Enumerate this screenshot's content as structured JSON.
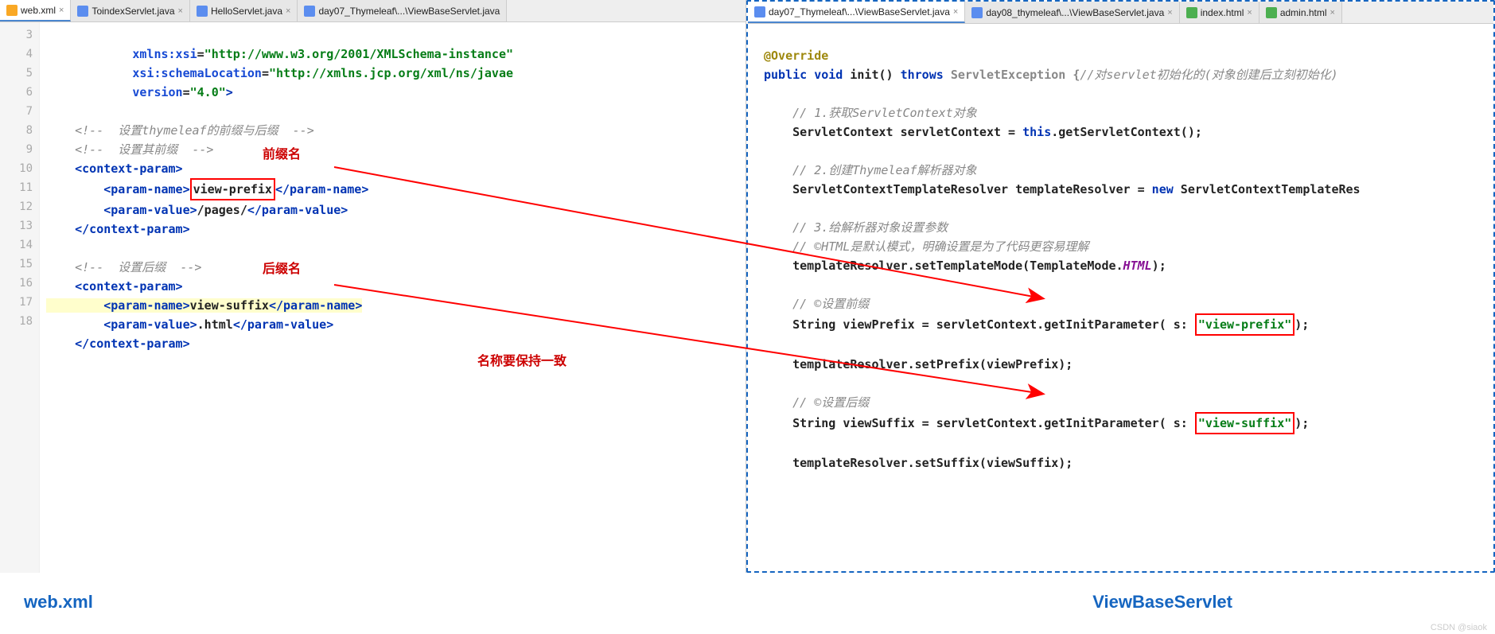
{
  "leftPane": {
    "tabs": [
      {
        "label": "web.xml",
        "icon": "xml-icon",
        "active": true
      },
      {
        "label": "ToindexServlet.java",
        "icon": "java-icon",
        "active": false
      },
      {
        "label": "HelloServlet.java",
        "icon": "java-icon",
        "active": false
      },
      {
        "label": "day07_Thymeleaf\\...\\ViewBaseServlet.java",
        "icon": "java-icon",
        "active": false
      }
    ],
    "lineStart": 3,
    "lineCount": 16,
    "code": {
      "l3": "            xmlns:xsi=\"http://www.w3.org/2001/XMLSchema-instance\"",
      "l4": "            xsi:schemaLocation=\"http://xmlns.jcp.org/xml/ns/javae",
      "l5": "            version=\"4.0\">",
      "l6": "",
      "l7": "    <!--  设置thymeleaf的前缀与后缀  -->",
      "l8": "    <!--  设置其前缀  -->",
      "l9a": "<",
      "l9b": "context-param",
      "l9c": ">",
      "l10a": "<",
      "l10b": "param-name",
      "l10c": ">",
      "l10d": "view-prefix",
      "l10e": "</",
      "l10f": "param-name",
      "l10g": ">",
      "l11a": "<",
      "l11b": "param-value",
      "l11c": ">",
      "l11d": "/pages/",
      "l11e": "</",
      "l11f": "param-value",
      "l11g": ">",
      "l12a": "</",
      "l12b": "context-param",
      "l12c": ">",
      "l14": "    <!--  设置后缀  -->",
      "l15a": "<",
      "l15b": "context-param",
      "l15c": ">",
      "l16a": "<",
      "l16b": "param-name",
      "l16c": ">",
      "l16d": "view-suffix",
      "l16e": "</",
      "l16f": "param-name",
      "l16g": ">",
      "l17a": "<",
      "l17b": "param-value",
      "l17c": ">",
      "l17d": ".html",
      "l17e": "</",
      "l17f": "param-value",
      "l17g": ">",
      "l18a": "</",
      "l18b": "context-param",
      "l18c": ">"
    },
    "labels": {
      "prefix": "前缀名",
      "suffix": "后缀名",
      "consist": "名称要保持一致"
    }
  },
  "rightPane": {
    "tabs": [
      {
        "label": "day07_Thymeleaf\\...\\ViewBaseServlet.java",
        "icon": "java-icon",
        "active": true
      },
      {
        "label": "day08_thymeleaf\\...\\ViewBaseServlet.java",
        "icon": "java-icon",
        "active": false
      },
      {
        "label": "index.html",
        "icon": "html-icon",
        "active": false
      },
      {
        "label": "admin.html",
        "icon": "html-icon",
        "active": false
      }
    ],
    "code": {
      "override": "@Override",
      "l2a": "public",
      "l2b": "void",
      "l2c": "init()",
      "l2d": "throws",
      "l2e": "ServletException {",
      "l2f": "//对servlet初始化的(对象创建后立刻初始化)",
      "l4": "// 1.获取ServletContext对象",
      "l5": "ServletContext servletContext = ",
      "l5b": "this",
      "l5c": ".getServletContext();",
      "l7": "// 2.创建Thymeleaf解析器对象",
      "l8a": "ServletContextTemplateResolver templateResolver = ",
      "l8b": "new",
      "l8c": " ServletContextTemplateRes",
      "l10": "// 3.给解析器对象设置参数",
      "l11": "// ©HTML是默认模式，明确设置是为了代码更容易理解",
      "l12a": "templateResolver.setTemplateMode(TemplateMode.",
      "l12b": "HTML",
      "l12c": ");",
      "l14": "// ©设置前缀",
      "l15a": "String viewPrefix = servletContext.getInitParameter( s:",
      "l15b": "\"view-prefix\"",
      "l15c": ");",
      "l17": "templateResolver.setPrefix(viewPrefix);",
      "l19": "// ©设置后缀",
      "l20a": "String viewSuffix = servletContext.getInitParameter( s:",
      "l20b": "\"view-suffix\"",
      "l20c": ");",
      "l22": "templateResolver.setSuffix(viewSuffix);"
    }
  },
  "footer": {
    "left": "web.xml",
    "right": "ViewBaseServlet"
  },
  "watermark": "CSDN @siaok"
}
